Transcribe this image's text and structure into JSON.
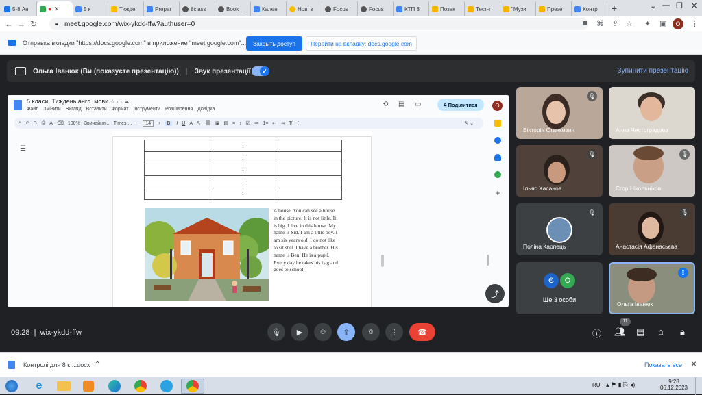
{
  "browser": {
    "tabs": [
      {
        "label": "5-8 Ан",
        "color": "#1a73e8"
      },
      {
        "label": "",
        "color": "#34a853"
      },
      {
        "label": "5 к",
        "color": "#4285f4"
      },
      {
        "label": "Тижде",
        "color": "#fbbc04"
      },
      {
        "label": "Prepar",
        "color": "#4285f4"
      },
      {
        "label": "8class",
        "color": "#555"
      },
      {
        "label": "Book_",
        "color": "#555"
      },
      {
        "label": "Кален",
        "color": "#4285f4"
      },
      {
        "label": "Нові з",
        "color": "#fbbc04"
      },
      {
        "label": "Focus",
        "color": "#555"
      },
      {
        "label": "Focus",
        "color": "#555"
      },
      {
        "label": "КТП 8",
        "color": "#4285f4"
      },
      {
        "label": "Позак",
        "color": "#f4b400"
      },
      {
        "label": "Тест-г",
        "color": "#f4b400"
      },
      {
        "label": "\"Музи",
        "color": "#f4b400"
      },
      {
        "label": "Презе",
        "color": "#f4b400"
      },
      {
        "label": "Контр",
        "color": "#4285f4"
      }
    ],
    "url": "meet.google.com/wix-ykdd-ffw?authuser=0",
    "profile": "O"
  },
  "infobar": {
    "text": "Отправка вкладки \"https://docs.google.com\" в приложение \"meet.google.com\"...",
    "grant_label": "Закрыть доступ",
    "goto_label": "Перейти на вкладку: docs.google.com"
  },
  "presenting": {
    "user_label": "Ольга Іванюк (Ви (показуєте презентацію))",
    "sound_label": "Звук презентації",
    "stop_label": "Зупинити презентацію"
  },
  "doc": {
    "title": "5 класи. Тиждень англ. мови",
    "menu": [
      "Файл",
      "Змінити",
      "Вигляд",
      "Вставити",
      "Формат",
      "Інструменти",
      "Розширення",
      "Довідка"
    ],
    "share_label": "Поділитися",
    "zoom": "100%",
    "style": "Звичайни...",
    "font": "Times ...",
    "font_size": "14",
    "table_rows": [
      [
        "",
        "i",
        ""
      ],
      [
        "",
        "i",
        ""
      ],
      [
        "",
        "i",
        ""
      ],
      [
        "",
        "i",
        ""
      ],
      [
        "",
        "i",
        ""
      ]
    ],
    "paragraph": "A house. You can see a house in the picture. It is not little. It is big. I live in this house. My name is Sid. I am a little boy. I am six years old. I do not like to sit still. I have a brother. His name is Ben. He is a pupil. Every day he takes his bag and goes to school."
  },
  "participants": [
    {
      "name": "Вікторія Станкович",
      "muted": true
    },
    {
      "name": "Анна Чистоградова",
      "muted": true
    },
    {
      "name": "Ільяс Хасанов",
      "muted": true
    },
    {
      "name": "Єгор Нікольніков",
      "muted": true
    },
    {
      "name": "Поліна Карпець",
      "muted": true
    },
    {
      "name": "Анастасія Афанасьєва",
      "muted": true
    },
    {
      "name": "Ще 3 особи",
      "avatars": [
        "Є",
        "О"
      ]
    },
    {
      "name": "Ольга Іванюк",
      "self": true
    }
  ],
  "meeting": {
    "time": "09:28",
    "code": "wix-ykdd-ffw",
    "people_count": "11"
  },
  "download": {
    "file": "Контролі для 8 к....docx",
    "show_all": "Показать все"
  },
  "taskbar": {
    "lang": "RU",
    "time": "9:28",
    "date": "06.12.2023"
  }
}
